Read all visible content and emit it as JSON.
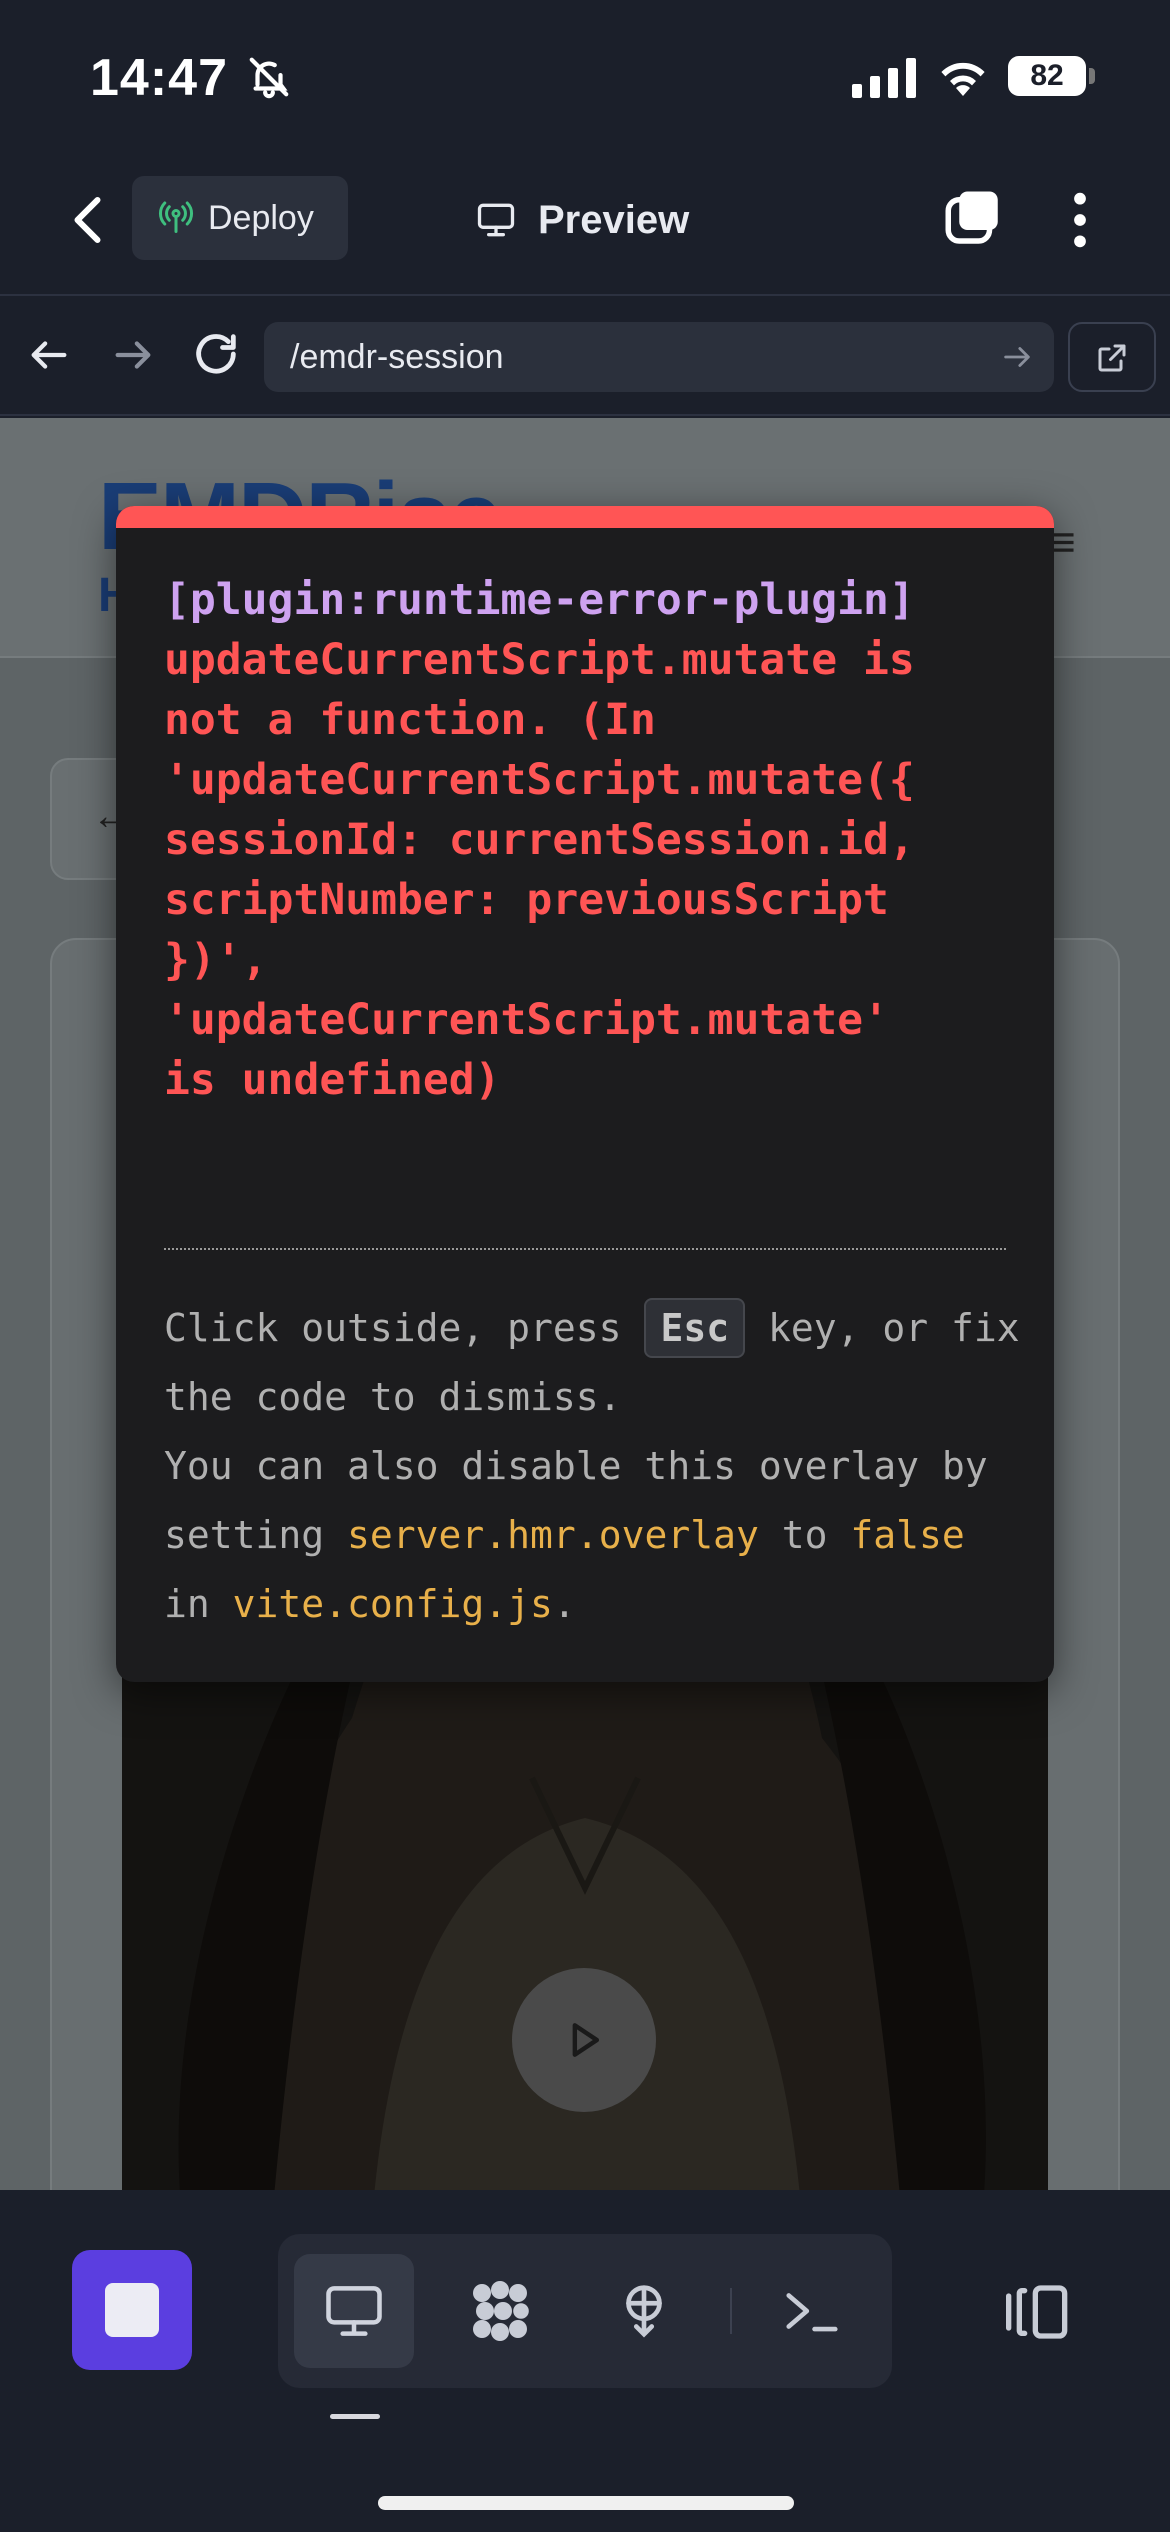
{
  "status_bar": {
    "time": "14:47",
    "battery": "82"
  },
  "header": {
    "deploy_label": "Deploy",
    "title": "Preview"
  },
  "browser": {
    "url": "/emdr-session"
  },
  "site": {
    "logo": "EMDRise",
    "subtitle_initial": "H",
    "menu_glyph": "≡",
    "back_glyph": "←"
  },
  "error_overlay": {
    "plugin": "[plugin:runtime-error-plugin]",
    "message_lines": [
      "updateCurrentScript.mutate is",
      "not a function. (In",
      "'updateCurrentScript.mutate({",
      "sessionId: currentSession.id,",
      "scriptNumber: previousScript",
      "})',",
      "'updateCurrentScript.mutate'",
      "is undefined)"
    ],
    "tip": {
      "part1": "Click outside, press ",
      "key": "Esc",
      "part2": " key, or fix the code to dismiss.",
      "part3": "You can also disable this overlay by setting ",
      "code1": "server.hmr.overlay",
      "part4": " to ",
      "code2": "false",
      "part5": " in ",
      "code3": "vite.config.js",
      "part6": "."
    }
  },
  "colors": {
    "accent": "#5b3ee0",
    "error": "#ff5555",
    "plugin": "#cea2f0",
    "code": "#e8b04a"
  }
}
